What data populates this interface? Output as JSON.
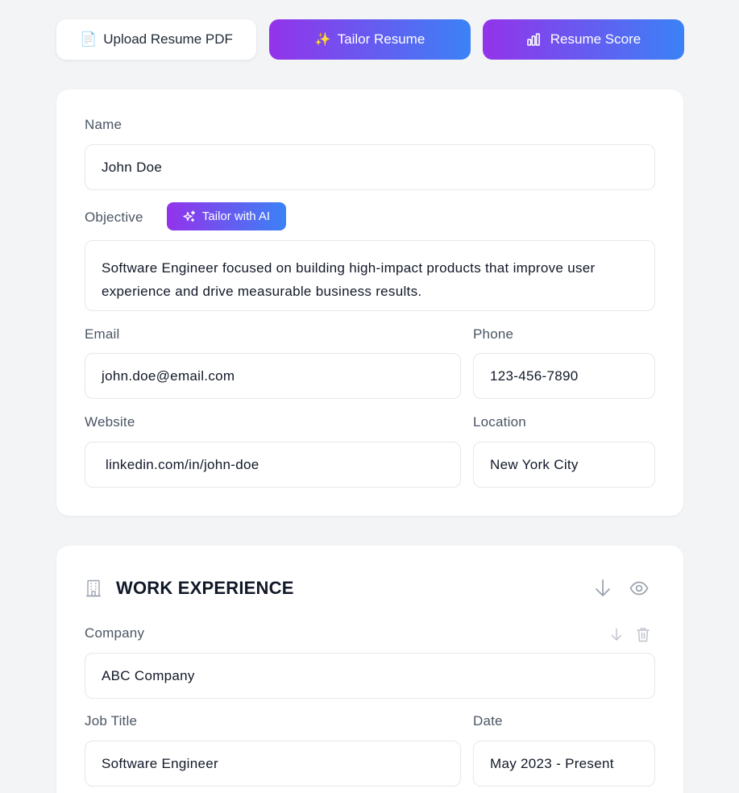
{
  "toolbar": {
    "upload_label": "Upload Resume PDF",
    "upload_icon": "📄",
    "tailor_label": "Tailor Resume",
    "tailor_icon": "✨",
    "score_label": "Resume Score"
  },
  "profile": {
    "name_label": "Name",
    "name_value": "John Doe",
    "objective_label": "Objective",
    "ai_button_label": "Tailor with AI",
    "objective_value": "Software Engineer focused on building high-impact products that improve user experience and drive measurable business results.",
    "email_label": "Email",
    "email_value": "john.doe@email.com",
    "phone_label": "Phone",
    "phone_value": "123-456-7890",
    "website_label": "Website",
    "website_value": "linkedin.com/in/john-doe",
    "location_label": "Location",
    "location_value": "New York City"
  },
  "work": {
    "section_title": "WORK EXPERIENCE",
    "company_label": "Company",
    "company_value": "ABC Company",
    "job_title_label": "Job Title",
    "job_title_value": "Software Engineer",
    "date_label": "Date",
    "date_value": "May 2023 - Present"
  },
  "colors": {
    "gradient_start": "#9333ea",
    "gradient_end": "#3b82f6",
    "background": "#f3f4f6"
  }
}
